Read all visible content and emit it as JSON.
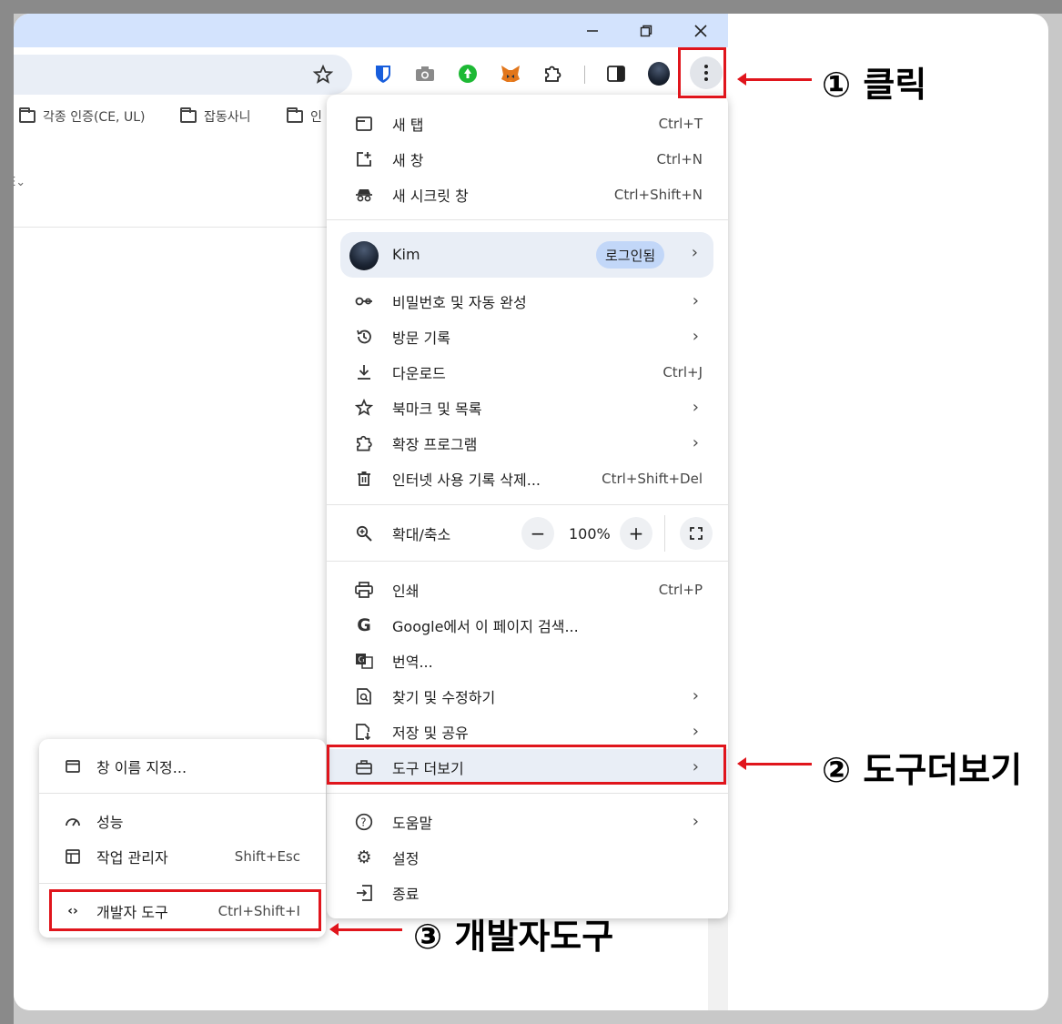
{
  "bookmarks": [
    {
      "label": "각종 인증(CE, UL)"
    },
    {
      "label": "잡동사니"
    },
    {
      "label": "인"
    }
  ],
  "page": {
    "side_label": "E⌄"
  },
  "menu": {
    "new_tab": {
      "label": "새 탭",
      "shortcut": "Ctrl+T"
    },
    "new_window": {
      "label": "새 창",
      "shortcut": "Ctrl+N"
    },
    "incognito": {
      "label": "새 시크릿 창",
      "shortcut": "Ctrl+Shift+N"
    },
    "profile": {
      "name": "Kim",
      "status": "로그인됨"
    },
    "passwords": {
      "label": "비밀번호 및 자동 완성"
    },
    "history": {
      "label": "방문 기록"
    },
    "downloads": {
      "label": "다운로드",
      "shortcut": "Ctrl+J"
    },
    "bookmarks": {
      "label": "북마크 및 목록"
    },
    "extensions": {
      "label": "확장 프로그램"
    },
    "clear_data": {
      "label": "인터넷 사용 기록 삭제...",
      "shortcut": "Ctrl+Shift+Del"
    },
    "zoom": {
      "label": "확대/축소",
      "value": "100%",
      "minus": "−",
      "plus": "+"
    },
    "print": {
      "label": "인쇄",
      "shortcut": "Ctrl+P"
    },
    "google_search": {
      "label": "Google에서 이 페이지 검색..."
    },
    "translate": {
      "label": "번역..."
    },
    "find_edit": {
      "label": "찾기 및 수정하기"
    },
    "save_share": {
      "label": "저장 및 공유"
    },
    "more_tools": {
      "label": "도구 더보기"
    },
    "help": {
      "label": "도움말"
    },
    "settings": {
      "label": "설정"
    },
    "exit": {
      "label": "종료"
    }
  },
  "submenu": {
    "name_window": {
      "label": "창 이름 지정..."
    },
    "performance": {
      "label": "성능"
    },
    "task_manager": {
      "label": "작업 관리자",
      "shortcut": "Shift+Esc"
    },
    "devtools": {
      "label": "개발자 도구",
      "shortcut": "Ctrl+Shift+I"
    }
  },
  "callouts": {
    "step1": "① 클릭",
    "step2": "② 도구더보기",
    "step3": "③ 개발자도구"
  },
  "colors": {
    "highlight": "#e0151c",
    "titlebar": "#d3e3fd",
    "profile_chip": "#c2d7f8"
  }
}
